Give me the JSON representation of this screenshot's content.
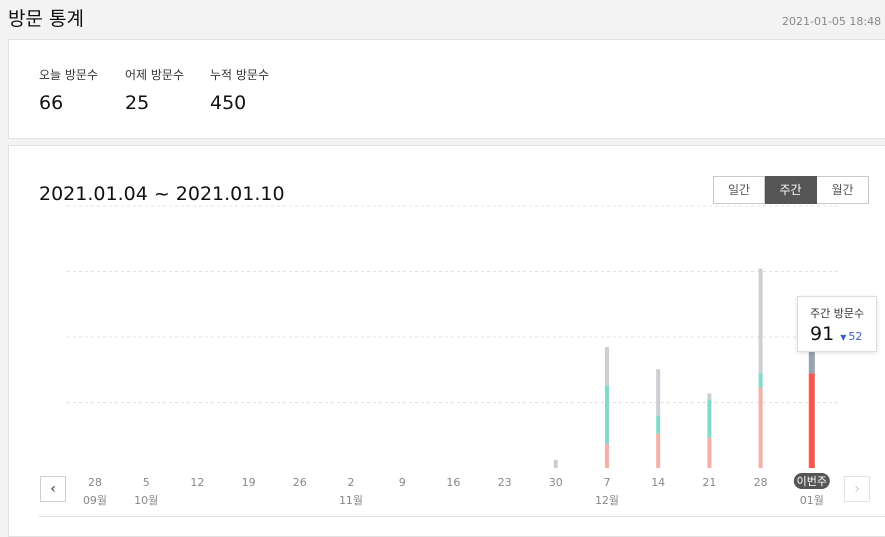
{
  "header": {
    "title": "방문 통계",
    "timestamp": "2021-01-05 18:48 기"
  },
  "summary": {
    "today": {
      "label": "오늘 방문수",
      "value": "66"
    },
    "yesterday": {
      "label": "어제 방문수",
      "value": "25"
    },
    "total": {
      "label": "누적 방문수",
      "value": "450"
    }
  },
  "chart_header": {
    "date_range": "2021.01.04 ~ 2021.01.10",
    "tabs": [
      {
        "label": "일간",
        "active": false
      },
      {
        "label": "주간",
        "active": true
      },
      {
        "label": "월간",
        "active": false
      }
    ]
  },
  "tooltip": {
    "label": "주간 방문수",
    "value": "91",
    "delta_arrow": "▼",
    "delta": "52"
  },
  "nav": {
    "prev_icon": "chevron-left-icon",
    "next_icon": "chevron-right-icon",
    "prev_glyph": "‹",
    "next_glyph": "›"
  },
  "colors": {
    "gray": "#cbcfd3",
    "teal": "#7fdccb",
    "salmon": "#f7aea6",
    "current_red": "#f5574b",
    "current_gray": "#97a3b1",
    "current_badge": "#555555",
    "delta_blue": "#3a62c4"
  },
  "chart_data": {
    "type": "bar",
    "stacked": true,
    "grid": "dashed horizontal",
    "categories": [
      "28",
      "5",
      "12",
      "19",
      "26",
      "2",
      "9",
      "16",
      "23",
      "30",
      "7",
      "14",
      "21",
      "28",
      "이번주"
    ],
    "months": [
      "09월",
      "10월",
      "",
      "",
      "",
      "11월",
      "",
      "",
      "",
      "",
      "12월",
      "",
      "",
      "",
      "01월"
    ],
    "current_index": 14,
    "series": [
      {
        "values": [
          0,
          0,
          0,
          0,
          0,
          0,
          0,
          0,
          0,
          0,
          12,
          17,
          15,
          40,
          47
        ]
      },
      {
        "values": [
          0,
          0,
          0,
          0,
          0,
          0,
          0,
          0,
          0,
          0,
          29,
          9,
          19,
          7,
          0
        ]
      },
      {
        "values": [
          0,
          0,
          0,
          0,
          0,
          0,
          0,
          0,
          0,
          4,
          19,
          23,
          3,
          52,
          15
        ]
      }
    ],
    "ylim": [
      0,
      130
    ]
  }
}
